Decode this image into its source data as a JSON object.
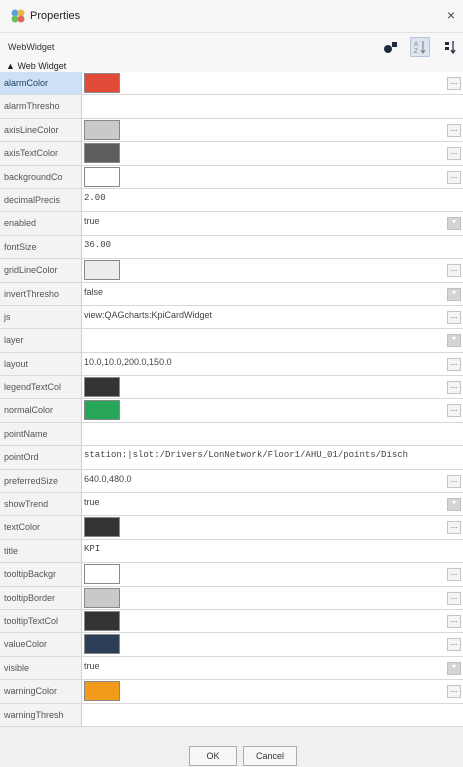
{
  "window": {
    "title": "Properties",
    "close_glyph": "×"
  },
  "toolbar": {
    "widget_name": "WebWidget",
    "icons": [
      "add-icon",
      "sort-az-icon",
      "sort-icon"
    ]
  },
  "section": {
    "label": "Web Widget",
    "arrow": "▲"
  },
  "properties": [
    {
      "name": "alarmColor",
      "kind": "color",
      "color": "#e24a3a",
      "btn": "..."
    },
    {
      "name": "alarmThresho",
      "kind": "text",
      "value": ""
    },
    {
      "name": "axisLineColor",
      "kind": "color",
      "color": "#c9c9c9",
      "btn": "..."
    },
    {
      "name": "axisTextColor",
      "kind": "color",
      "color": "#5e5e5e",
      "btn": "..."
    },
    {
      "name": "backgroundCo",
      "kind": "color",
      "color": "#ffffff",
      "btn": "..."
    },
    {
      "name": "decimalPrecis",
      "kind": "text",
      "value": "2.00",
      "mono": true
    },
    {
      "name": "enabled",
      "kind": "text",
      "value": "true",
      "btn": "▾",
      "drop": true
    },
    {
      "name": "fontSize",
      "kind": "text",
      "value": "36.00",
      "mono": true
    },
    {
      "name": "gridLineColor",
      "kind": "color",
      "color": "#ececec",
      "btn": "..."
    },
    {
      "name": "invertThresho",
      "kind": "text",
      "value": "false",
      "btn": "▾",
      "drop": true
    },
    {
      "name": "js",
      "kind": "text",
      "value": "view:QAGcharts:KpiCardWidget",
      "btn": "..."
    },
    {
      "name": "layer",
      "kind": "text",
      "value": "",
      "btn": "▾",
      "drop": true
    },
    {
      "name": "layout",
      "kind": "text",
      "value": "10.0,10.0,200.0,150.0",
      "btn": "..."
    },
    {
      "name": "legendTextCol",
      "kind": "color",
      "color": "#333333",
      "btn": "..."
    },
    {
      "name": "normalColor",
      "kind": "color",
      "color": "#27a65a",
      "btn": "..."
    },
    {
      "name": "pointName",
      "kind": "text",
      "value": ""
    },
    {
      "name": "pointOrd",
      "kind": "text",
      "value": "station:|slot:/Drivers/LonNetwork/Floor1/AHU_01/points/Disch",
      "mono": true
    },
    {
      "name": "preferredSize",
      "kind": "text",
      "value": "640.0,480.0",
      "btn": "..."
    },
    {
      "name": "showTrend",
      "kind": "text",
      "value": "true",
      "btn": "▾",
      "drop": true
    },
    {
      "name": "textColor",
      "kind": "color",
      "color": "#333333",
      "btn": "..."
    },
    {
      "name": "title",
      "kind": "text",
      "value": "KPI",
      "mono": true
    },
    {
      "name": "tooltipBackgr",
      "kind": "color",
      "color": "#ffffff",
      "btn": "..."
    },
    {
      "name": "tooltipBorder",
      "kind": "color",
      "color": "#c9c9c9",
      "btn": "..."
    },
    {
      "name": "tooltipTextCol",
      "kind": "color",
      "color": "#333333",
      "btn": "..."
    },
    {
      "name": "valueColor",
      "kind": "color",
      "color": "#2c3e55",
      "btn": "..."
    },
    {
      "name": "visible",
      "kind": "text",
      "value": "true",
      "btn": "▾",
      "drop": true
    },
    {
      "name": "warningColor",
      "kind": "color",
      "color": "#f29a1a",
      "btn": "..."
    },
    {
      "name": "warningThresh",
      "kind": "text",
      "value": ""
    }
  ],
  "footer": {
    "ok_label": "OK",
    "cancel_label": "Cancel"
  },
  "colors": {
    "selected_row_bg": "#cde0f6"
  }
}
